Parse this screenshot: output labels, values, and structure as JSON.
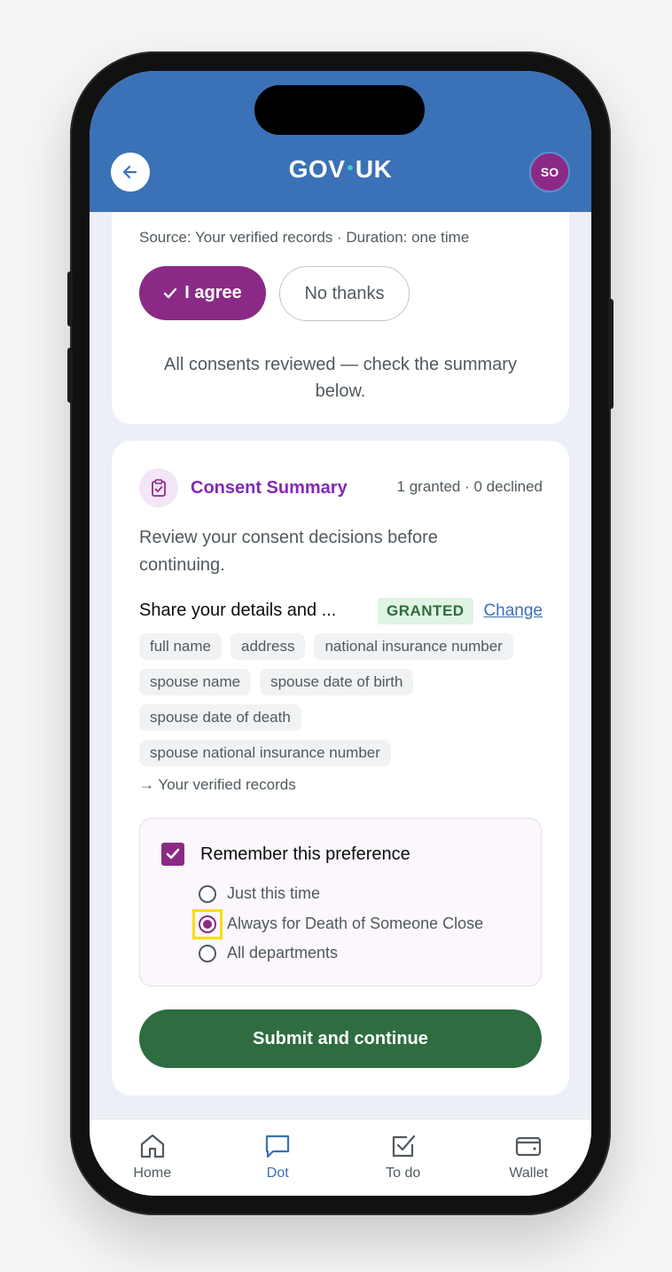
{
  "header": {
    "logo_left": "GOV",
    "logo_dot": "•",
    "logo_right": "UK",
    "avatar_initials": "SO",
    "back_icon": "arrow-left-icon",
    "color": "#3b71b6"
  },
  "consent_card": {
    "source_text": "Source: Your verified records · Duration: one time",
    "agree_label": "I agree",
    "no_thanks_label": "No thanks",
    "reviewed_text": "All consents reviewed — check the summary below."
  },
  "summary": {
    "title": "Consent Summary",
    "counts": "1 granted · 0 declined",
    "description": "Review your consent decisions before continuing.",
    "item": {
      "title": "Share your details and ...",
      "status": "GRANTED",
      "change_label": "Change",
      "fields": [
        "full name",
        "address",
        "national insurance number",
        "spouse name",
        "spouse date of birth",
        "spouse date of death",
        "spouse national insurance number"
      ],
      "destination": "→ Your verified records"
    },
    "preference": {
      "checkbox_label": "Remember this preference",
      "checked": true,
      "options": [
        "Just this time",
        "Always for Death of Someone Close",
        "All departments"
      ],
      "selected_index": 1
    },
    "submit_label": "Submit and continue"
  },
  "tabbar": {
    "tabs": [
      {
        "label": "Home",
        "icon": "home-icon"
      },
      {
        "label": "Dot",
        "icon": "chat-icon",
        "active": true
      },
      {
        "label": "To do",
        "icon": "checkbox-icon"
      },
      {
        "label": "Wallet",
        "icon": "wallet-icon"
      }
    ]
  },
  "colors": {
    "brand_purple": "#8b2a86",
    "accent_green": "#2f6d41",
    "link_blue": "#3b71b6"
  }
}
